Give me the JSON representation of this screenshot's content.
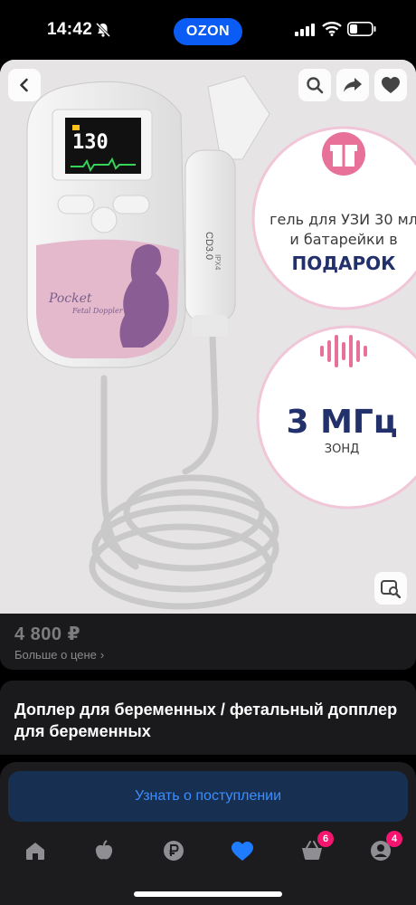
{
  "status_bar": {
    "time": "14:42",
    "app_badge": "OZON"
  },
  "product_image": {
    "device_screen_reading": "130",
    "device_brand": "Pocket",
    "device_subtitle": "Fetal Doppler",
    "probe_label": "CD3.0",
    "probe_sub": "IPX4",
    "promo_gift": {
      "line1": "гель для УЗИ 30 мл",
      "line2": "и батарейки в",
      "line3": "ПОДАРОК"
    },
    "promo_freq": {
      "value": "3 МГц",
      "label": "ЗОНД"
    }
  },
  "price": {
    "value": "4 800 ₽",
    "more_label": "Больше о цене"
  },
  "product": {
    "title": "Доплер для беременных / фетальный допплер для беременных"
  },
  "actions": {
    "notify_label": "Узнать о поступлении"
  },
  "tabbar": {
    "items": [
      {
        "name": "home",
        "icon": "home-icon"
      },
      {
        "name": "fresh",
        "icon": "apple-icon"
      },
      {
        "name": "finance",
        "icon": "ruble-icon"
      },
      {
        "name": "favorites",
        "icon": "heart-icon",
        "active": true
      },
      {
        "name": "cart",
        "icon": "basket-icon",
        "badge": "6"
      },
      {
        "name": "profile",
        "icon": "profile-icon",
        "badge": "4"
      }
    ]
  },
  "colors": {
    "accent": "#3d8dff",
    "brand": "#0a5cf5",
    "badge": "#f6166f",
    "promo_pink": "#e8719a",
    "promo_navy": "#22306b"
  }
}
